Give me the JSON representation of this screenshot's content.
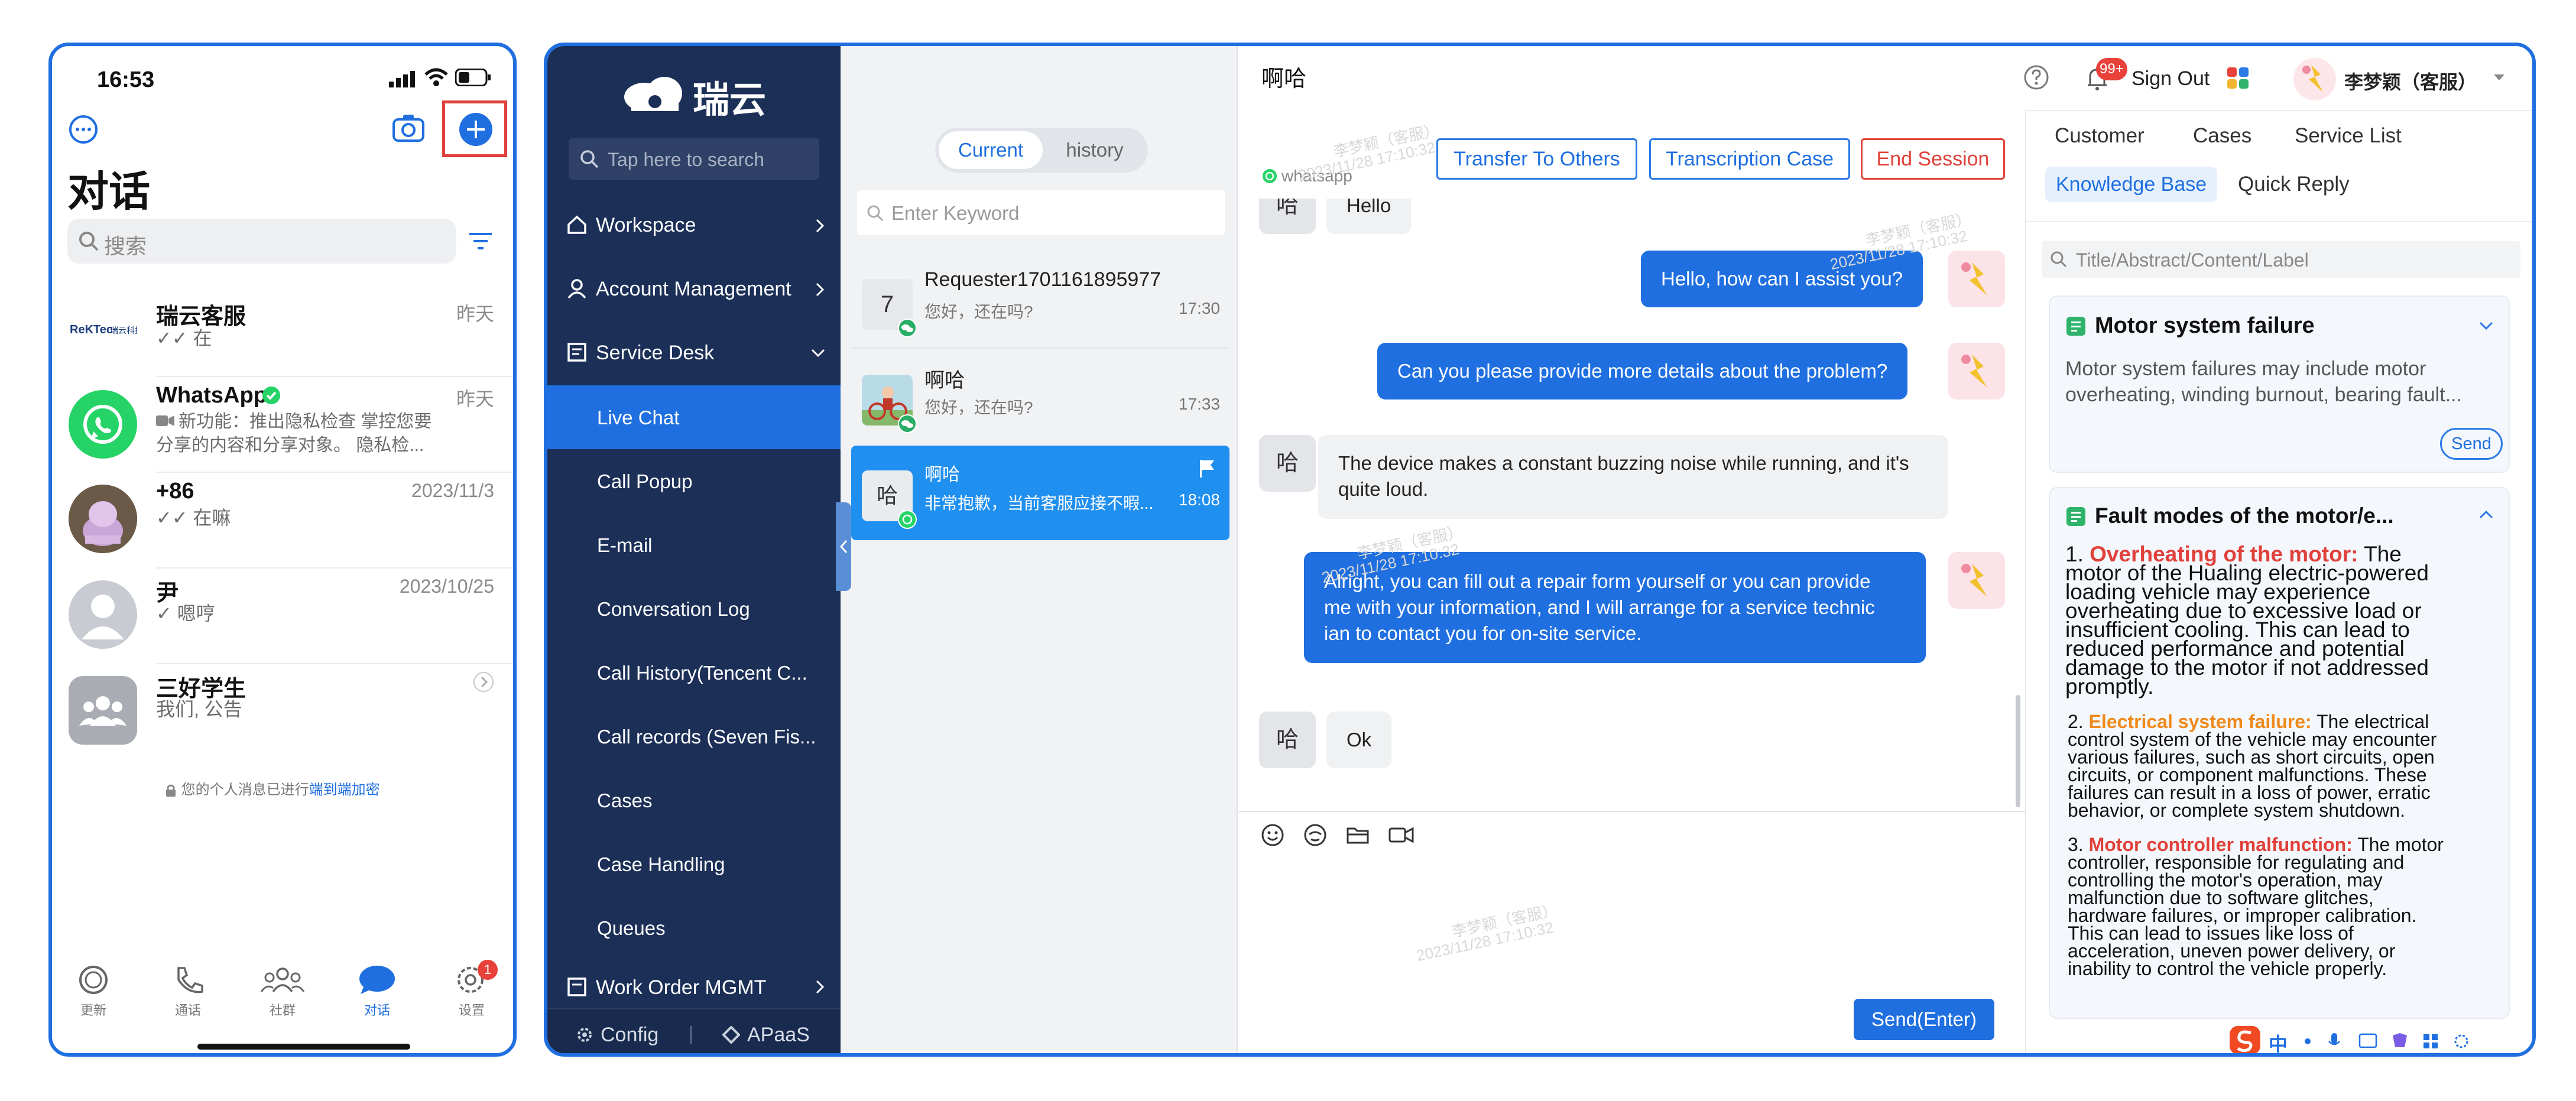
{
  "phone": {
    "time": "16:53",
    "title": "对话",
    "search_placeholder": "搜索",
    "chats": [
      {
        "name": "瑞云客服",
        "time": "昨天",
        "preview": "✓✓ 在"
      },
      {
        "name": "WhatsApp",
        "time": "昨天",
        "preview_line1": "新功能：推出隐私检查    掌控您要",
        "preview_line2": "分享的内容和分享对象。     隐私检..."
      },
      {
        "name": "+86",
        "time": "2023/11/3",
        "preview": "✓✓ 在嘛"
      },
      {
        "name": "尹",
        "time": "2023/10/25",
        "preview": "✓ 嗯哼"
      },
      {
        "name": "三好学生",
        "time": "",
        "preview": "我们, 公告"
      }
    ],
    "encryption_notice_prefix": "您的个人消息已进行",
    "encryption_notice_link": "端到端加密",
    "tabs": [
      "更新",
      "通话",
      "社群",
      "对话",
      "设置"
    ],
    "settings_badge": "1",
    "colors": {
      "accent": "#1f6fe0",
      "highlight_box": "#e0413a",
      "whatsapp_green": "#25d366"
    }
  },
  "app": {
    "logo_text": "瑞云",
    "sidebar": {
      "search_placeholder": "Tap here to search",
      "items": [
        {
          "label": "Workspace"
        },
        {
          "label": "Account Management"
        },
        {
          "label": "Service Desk"
        }
      ],
      "sub_items": [
        "Live Chat",
        "Call Popup",
        "E-mail",
        "Conversation Log",
        "Call History(Tencent C...",
        "Call records (Seven Fis...",
        "Cases",
        "Case Handling",
        "Queues"
      ],
      "bottom_item": "Work Order MGMT",
      "config_label": "Config",
      "apaas_label": "APaaS"
    },
    "header": {
      "notif_badge": "99+",
      "sign_out": "Sign Out",
      "user_name": "李梦颖（客服）"
    },
    "conversations": {
      "tab_current": "Current",
      "tab_history": "history",
      "search_placeholder": "Enter Keyword",
      "items": [
        {
          "avatar_text": "7",
          "name": "Requester1701161895977",
          "preview": "您好，还在吗?",
          "time": "17:30"
        },
        {
          "avatar_text": "",
          "name": "啊哈",
          "preview": "您好，还在吗?",
          "time": "17:33"
        },
        {
          "avatar_text": "哈",
          "name": "啊哈",
          "preview": "非常抱歉，当前客服应接不暇...",
          "time": "18:08"
        }
      ]
    },
    "chat": {
      "contact_name": "啊哈",
      "channel": "whatsapp",
      "buttons": {
        "transfer": "Transfer To Others",
        "transcription": "Transcription Case",
        "end": "End Session"
      },
      "messages": [
        {
          "dir": "in",
          "avatar": "哈",
          "text": "Hello"
        },
        {
          "dir": "out",
          "text": "Hello, how can I assist you?"
        },
        {
          "dir": "out",
          "text": "Can you please provide more details about the problem?"
        },
        {
          "dir": "in",
          "avatar": "哈",
          "lines": [
            "The device makes a constant buzzing noise while running, and it's",
            "quite loud."
          ]
        },
        {
          "dir": "out",
          "lines": [
            "Alright, you can fill out a repair form yourself or you can provide",
            "me with your information, and I will arrange for a service technic",
            "ian to contact you for on-site service."
          ]
        },
        {
          "dir": "in",
          "avatar": "哈",
          "text": "Ok"
        }
      ],
      "send_label": "Send(Enter)",
      "watermark_name": "李梦颖（客服）",
      "watermark_time": "2023/11/28 17:10:32"
    },
    "right_panel": {
      "tabs_row1": [
        "Customer",
        "Cases",
        "Service List"
      ],
      "tabs_row2": [
        "Knowledge Base",
        "Quick Reply"
      ],
      "search_placeholder": "Title/Abstract/Content/Label",
      "card1": {
        "title": "Motor system failure",
        "body_line1": "Motor system failures may include motor",
        "body_line2": "overheating, winding burnout, bearing fault...",
        "send": "Send"
      },
      "card2": {
        "title": "Fault modes of the motor/e...",
        "p1_num": "1.",
        "p1_head": "Overheating of the motor:",
        "p1_lines": [
          " The",
          "motor of the Hualing electric-powered",
          "loading vehicle may experience",
          "overheating due to excessive load or",
          "insufficient cooling. This can lead to",
          "reduced performance and potential",
          "damage to the motor if not addressed",
          "promptly."
        ],
        "p2_num": "2.",
        "p2_head": "Electrical system failure:",
        "p2_lines": [
          " The electrical",
          "control system of the vehicle may encounter",
          "various failures, such as short circuits, open",
          "circuits, or component malfunctions. These",
          "failures can result in a loss of power, erratic",
          "behavior, or complete system shutdown."
        ],
        "p3_num": "3.",
        "p3_head": "Motor controller malfunction:",
        "p3_lines": [
          " The motor",
          "controller, responsible for regulating and",
          "controlling the motor's operation, may",
          "malfunction due to software glitches,",
          "hardware failures, or improper calibration.",
          "This can lead to issues like loss of",
          "acceleration, uneven power delivery, or",
          "inability to control the vehicle properly."
        ]
      },
      "ime_label": "中"
    },
    "colors": {
      "sidebar_bg": "#1b2f57",
      "active_item": "#1f6fe0",
      "end_session_red": "#e0413a"
    }
  }
}
